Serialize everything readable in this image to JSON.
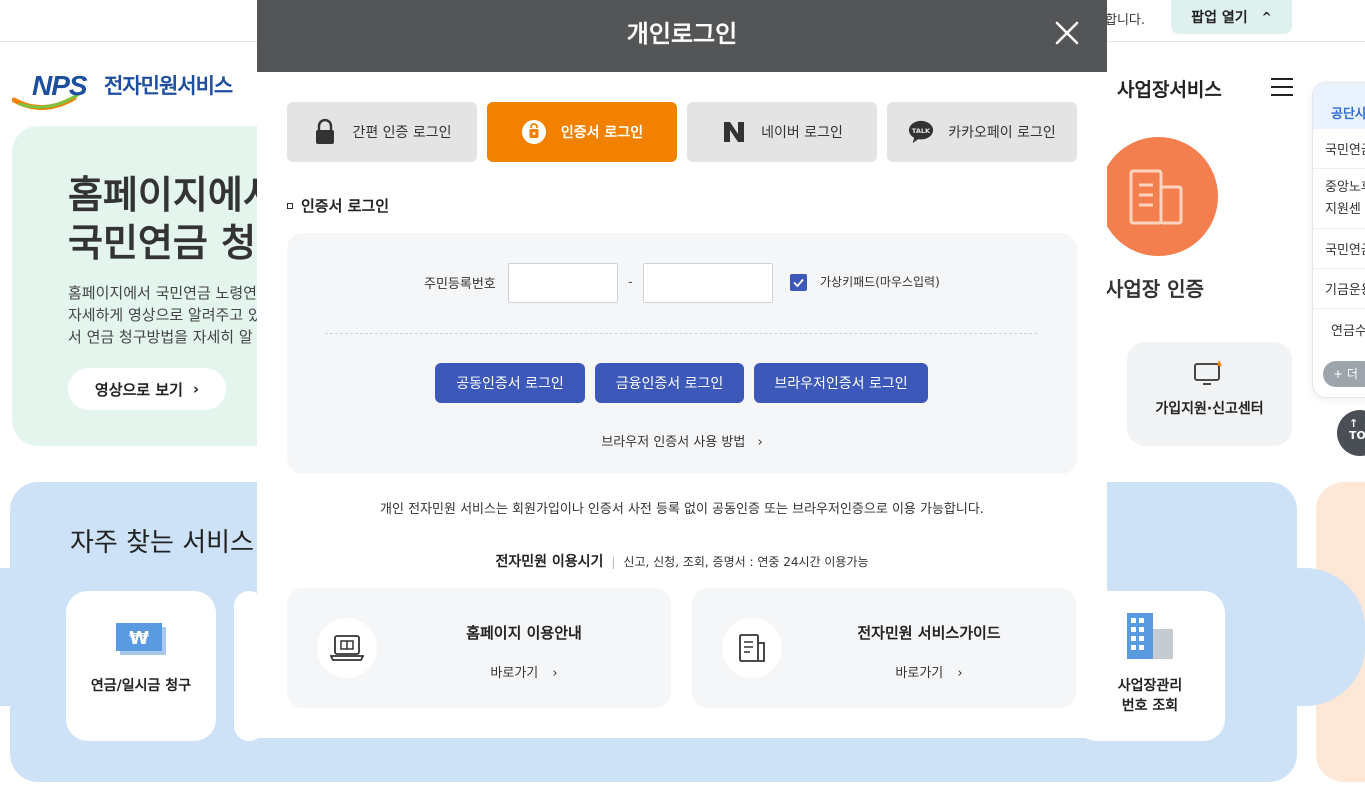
{
  "top_bar": {
    "notice_text": "합니다.",
    "popup_button": "팝업 열기",
    "chevron": "^"
  },
  "header": {
    "logo_letters": "NPS",
    "logo_text": "전자민원서비스",
    "nav_business": "사업장서비스"
  },
  "hero": {
    "title": "홈페이지에서\n국민연금 청구",
    "description": "홈페이지에서 국민연금 노령연\n자세하게 영상으로 알려주고 있\n서 연금 청구방법을 자세히 알",
    "video_button": "영상으로 보기",
    "chevron": "›"
  },
  "business": {
    "cert_label": "사업장 인증",
    "support_center": "가입지원·신고센터"
  },
  "quick_panel": {
    "header": "공단사",
    "items": [
      "국민연금",
      "중앙노후\n지원센",
      "국민연금",
      "기금운용",
      "연금수"
    ],
    "more_button": "+ 더",
    "top_button": "TOP"
  },
  "frequent": {
    "title": "자주 찾는 서비스",
    "cards": [
      {
        "label": "연금/일시금 청구"
      },
      {
        "label": "사업장관리\n번호 조회"
      }
    ]
  },
  "modal": {
    "title": "개인로그인",
    "close_glyph": "✕",
    "tabs": [
      {
        "label": "간편 인증 로그인"
      },
      {
        "label": "인증서 로그인"
      },
      {
        "label": "네이버 로그인"
      },
      {
        "label": "카카오페이 로그인"
      }
    ],
    "section_title": "인증서 로그인",
    "form": {
      "rrn_label": "주민등록번호",
      "rrn_front_value": "",
      "rrn_back_value": "",
      "dash": "-",
      "virtual_keypad_label": "가상키패드(마우스입력)",
      "virtual_keypad_checked": true
    },
    "buttons": {
      "joint_cert": "공동인증서 로그인",
      "financial_cert": "금융인증서 로그인",
      "browser_cert": "브라우저인증서 로그인"
    },
    "browser_howto": "브라우저 인증서 사용 방법",
    "chevron": "›",
    "notice": "개인 전자민원 서비스는 회원가입이나 인증서 사전 등록 없이 공동인증 또는 브라우저인증으로 이용 가능합니다.",
    "hours": {
      "title": "전자민원 이용시기",
      "detail": "신고, 신청, 조회, 증명서 : 연중 24시간 이용가능"
    },
    "guide_cards": [
      {
        "title": "홈페이지 이용안내",
        "link": "바로가기"
      },
      {
        "title": "전자민원 서비스가이드",
        "link": "바로가기"
      }
    ]
  },
  "colors": {
    "accent_orange": "#f28100",
    "button_blue": "#3c58b8",
    "header_gray": "#545557",
    "brand_blue": "#1d4f9e"
  },
  "icons": {
    "lock": "lock-icon",
    "certificate": "certificate-icon",
    "naver": "naver-icon",
    "kakao": "kakaotalk-icon",
    "close": "close-icon",
    "laptop": "laptop-icon",
    "guide": "document-icon",
    "building": "building-icon",
    "won": "won-icon"
  }
}
